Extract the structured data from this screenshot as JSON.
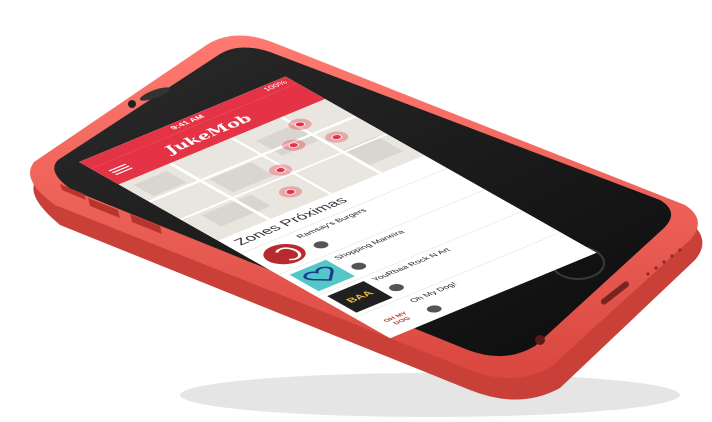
{
  "status_bar": {
    "carrier": "",
    "time": "9:41 AM",
    "battery": "100%"
  },
  "app": {
    "title": "JukeMob"
  },
  "section": {
    "title": "Zones Próximas"
  },
  "venues": [
    {
      "name": "Ramsay's Burgers",
      "address": "",
      "song": ""
    },
    {
      "name": "Shopping Maneira",
      "address": "",
      "song": ""
    },
    {
      "name": "YouRbaa Rock N Art",
      "address": "",
      "song": ""
    },
    {
      "name": "Oh My Dog!",
      "address": "",
      "song": ""
    }
  ],
  "brand_colors": {
    "accent": "#e53346",
    "phone_body": "#f25f5c"
  }
}
